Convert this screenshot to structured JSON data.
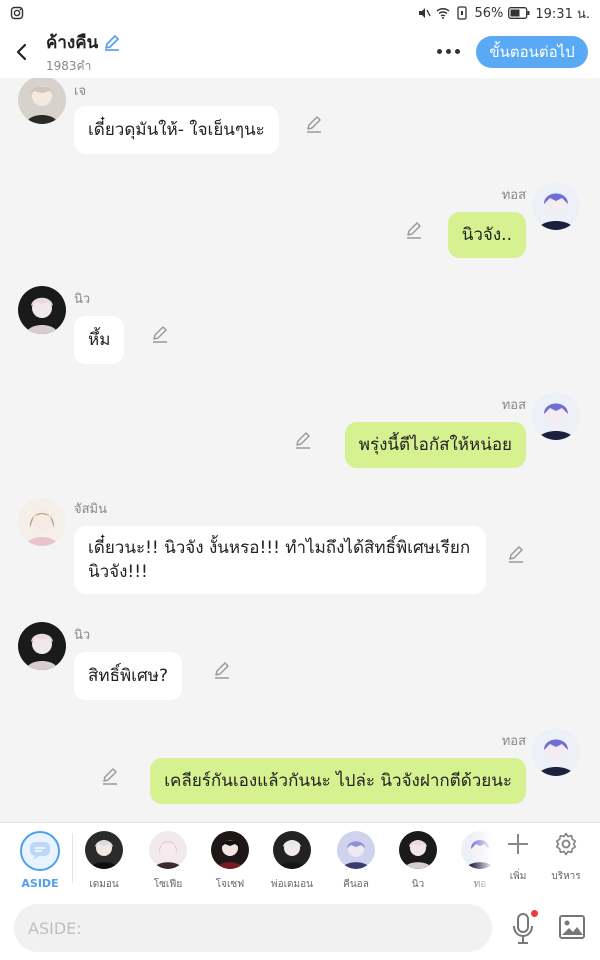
{
  "status_bar": {
    "battery": "56%",
    "time": "19:31 น.",
    "icons": [
      "instagram-icon",
      "mute-icon",
      "wifi-icon",
      "data-icon",
      "battery-icon"
    ]
  },
  "header": {
    "title": "ค้างคืน",
    "subtitle": "1983คำ",
    "next_label": "ขั้นตอนต่อไป"
  },
  "messages": [
    {
      "side": "left",
      "name": "เจ",
      "text": "เดี๋ยวดุมันให้- ใจเย็นๆนะ"
    },
    {
      "side": "right",
      "name": "ทอส",
      "text": "นิวจัง.."
    },
    {
      "side": "left",
      "name": "นิว",
      "text": "หึ้ม"
    },
    {
      "side": "right",
      "name": "ทอส",
      "text": "พรุ่งนี้ตีไอกัสให้หน่อย"
    },
    {
      "side": "left",
      "name": "จัสมิน",
      "text": "เดี๋ยวนะ!! นิวจัง งั้นหรอ!!! ทำไมถึงได้สิทธิ์พิเศษเรียกนิวจัง!!!"
    },
    {
      "side": "left",
      "name": "นิว",
      "text": "สิทธิ์พิเศษ?"
    },
    {
      "side": "right",
      "name": "ทอส",
      "text": "เคลียร์กันเองแล้วกันนะ ไปล่ะ นิวจังฝากตีด้วยนะ"
    }
  ],
  "characters": {
    "aside_label": "ASIDE",
    "items": [
      {
        "label": "เดมอน"
      },
      {
        "label": "โซเฟีย"
      },
      {
        "label": "โจเซฟ"
      },
      {
        "label": "พ่อเดมอน"
      },
      {
        "label": "คีนอล"
      },
      {
        "label": "นิว"
      },
      {
        "label": "ทอ"
      }
    ],
    "add_label": "เพิ่ม",
    "manage_label": "บริหาร"
  },
  "input": {
    "placeholder": "ASIDE:"
  },
  "colors": {
    "accent": "#5aa9f5",
    "right_bubble": "#d6f18f",
    "left_bubble": "#ffffff",
    "background": "#f4f4f4"
  }
}
